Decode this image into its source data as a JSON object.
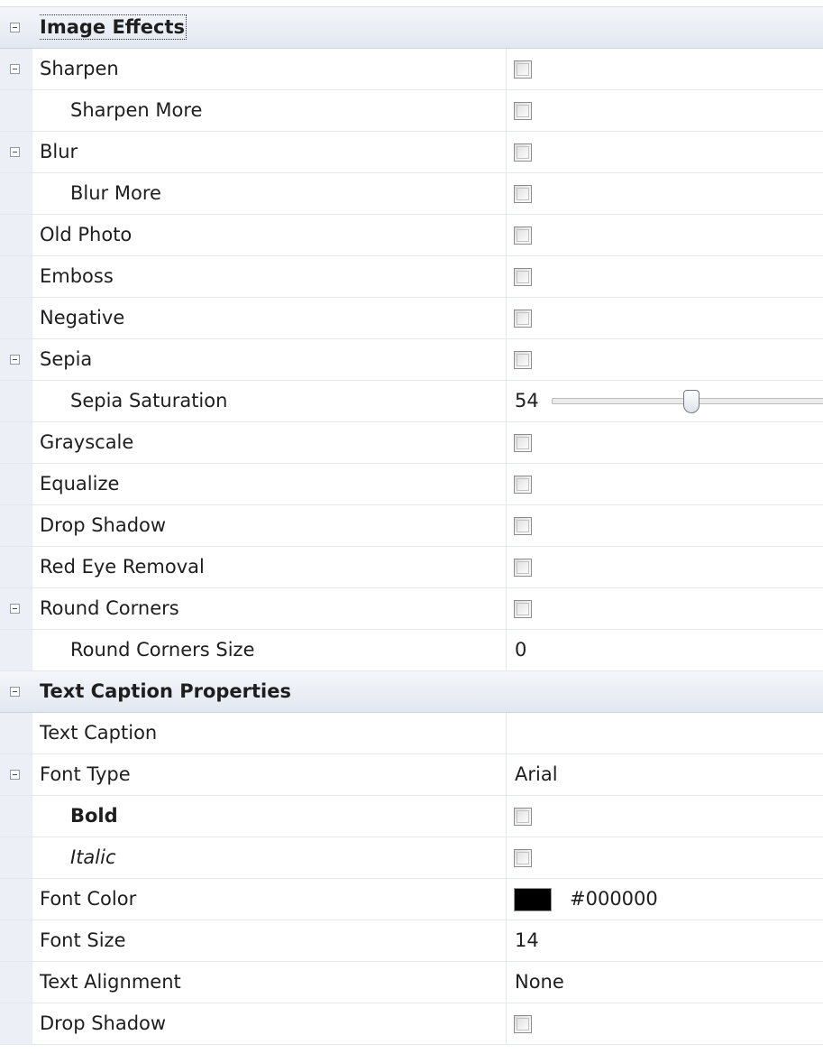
{
  "property_grid": {
    "rows": [
      {
        "kind": "category",
        "expander": "collapse-icon",
        "label": "Image Effects",
        "focused": true
      },
      {
        "expander": "collapse-icon",
        "label": "Sharpen",
        "editor": "checkbox",
        "checked": false
      },
      {
        "label": "Sharpen More",
        "indent": true,
        "editor": "checkbox",
        "checked": false
      },
      {
        "expander": "collapse-icon",
        "label": "Blur",
        "editor": "checkbox",
        "checked": false
      },
      {
        "label": "Blur More",
        "indent": true,
        "editor": "checkbox",
        "checked": false
      },
      {
        "label": "Old Photo",
        "editor": "checkbox",
        "checked": false
      },
      {
        "label": "Emboss",
        "editor": "checkbox",
        "checked": false
      },
      {
        "label": "Negative",
        "editor": "checkbox",
        "checked": false
      },
      {
        "expander": "collapse-icon",
        "label": "Sepia",
        "editor": "checkbox",
        "checked": false
      },
      {
        "label": "Sepia Saturation",
        "indent": true,
        "editor": "slider",
        "value": "54",
        "slider_fraction": 0.5
      },
      {
        "label": "Grayscale",
        "editor": "checkbox",
        "checked": false
      },
      {
        "label": "Equalize",
        "editor": "checkbox",
        "checked": false
      },
      {
        "label": "Drop Shadow",
        "editor": "checkbox",
        "checked": false
      },
      {
        "label": "Red Eye Removal",
        "editor": "checkbox",
        "checked": false
      },
      {
        "expander": "collapse-icon",
        "label": "Round Corners",
        "editor": "checkbox",
        "checked": false
      },
      {
        "label": "Round Corners Size",
        "indent": true,
        "editor": "text",
        "value": "0"
      },
      {
        "kind": "category",
        "expander": "collapse-icon",
        "label": "Text Caption Properties"
      },
      {
        "label": "Text Caption",
        "editor": "text",
        "value": ""
      },
      {
        "expander": "collapse-icon",
        "label": "Font Type",
        "editor": "text",
        "value": "Arial"
      },
      {
        "label": "Bold",
        "indent": true,
        "style": "bold",
        "editor": "checkbox",
        "checked": false
      },
      {
        "label": "Italic",
        "indent": true,
        "style": "italic",
        "editor": "checkbox",
        "checked": false
      },
      {
        "label": "Font Color",
        "editor": "color",
        "value": "#000000",
        "swatch": "#000000"
      },
      {
        "label": "Font Size",
        "editor": "text",
        "value": "14"
      },
      {
        "label": "Text Alignment",
        "editor": "text",
        "value": "None"
      },
      {
        "label": "Drop Shadow",
        "editor": "checkbox",
        "checked": false
      }
    ]
  },
  "colors": {
    "gutter": "#ecf0f6",
    "category_header": "#e2e7f0",
    "grid_line": "#e4e8ee"
  }
}
